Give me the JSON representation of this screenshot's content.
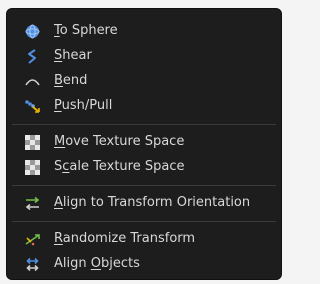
{
  "menu": {
    "groups": [
      {
        "items": [
          {
            "key": "to_sphere",
            "icon": "sphere-icon",
            "pre": "",
            "ul": "T",
            "post": "o Sphere"
          },
          {
            "key": "shear",
            "icon": "shear-icon",
            "pre": "",
            "ul": "S",
            "post": "hear"
          },
          {
            "key": "bend",
            "icon": "bend-icon",
            "pre": "",
            "ul": "B",
            "post": "end"
          },
          {
            "key": "push_pull",
            "icon": "push-pull-icon",
            "pre": "",
            "ul": "P",
            "post": "ush/Pull"
          }
        ]
      },
      {
        "items": [
          {
            "key": "move_texture_space",
            "icon": "checker-texture-icon",
            "pre": "",
            "ul": "M",
            "post": "ove Texture Space"
          },
          {
            "key": "scale_texture_space",
            "icon": "checker-texture-icon",
            "pre": "S",
            "ul": "c",
            "post": "ale Texture Space"
          }
        ]
      },
      {
        "items": [
          {
            "key": "align_transform_orientation",
            "icon": "align-orientation-icon",
            "pre": "",
            "ul": "A",
            "post": "lign to Transform Orientation"
          }
        ]
      },
      {
        "items": [
          {
            "key": "randomize_transform",
            "icon": "randomize-icon",
            "pre": "",
            "ul": "R",
            "post": "andomize Transform"
          },
          {
            "key": "align_objects",
            "icon": "align-objects-icon",
            "pre": "Align ",
            "ul": "O",
            "post": "bjects"
          }
        ]
      }
    ]
  },
  "colors": {
    "background": "#1d1d1d",
    "text": "#d8d8d8",
    "separator": "#3a3a3a",
    "accent_blue": "#4f8ee0",
    "accent_green": "#6fbf4a",
    "icon_gray": "#cfcfcf"
  }
}
